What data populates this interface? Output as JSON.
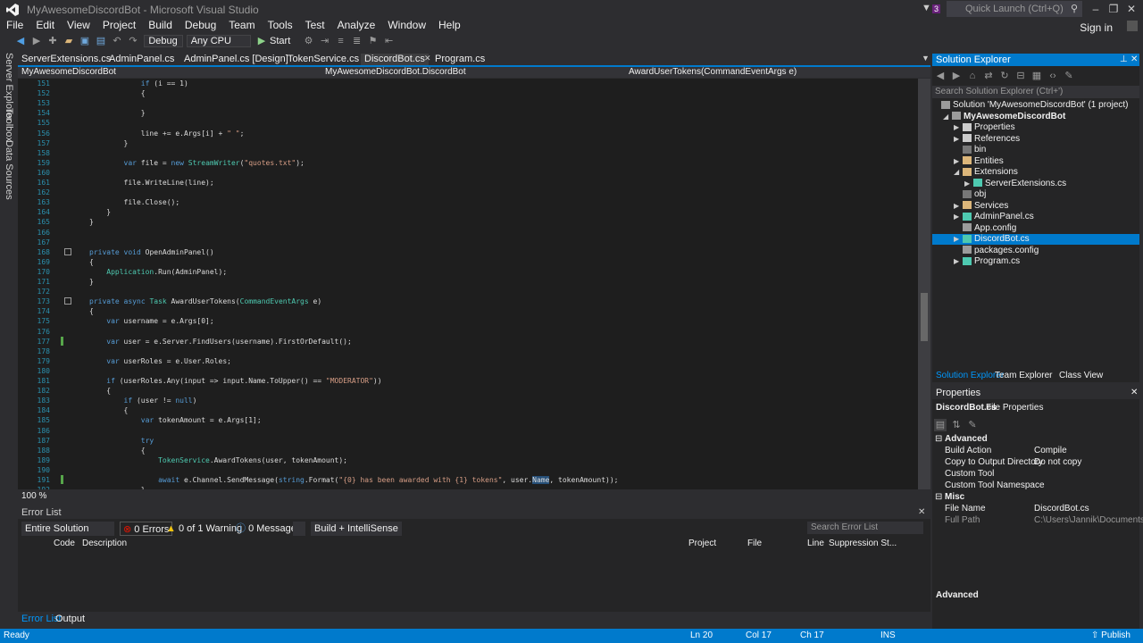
{
  "window": {
    "title": "MyAwesomeDiscordBot - Microsoft Visual Studio",
    "quick_launch_placeholder": "Quick Launch (Ctrl+Q)",
    "notification_count": "3",
    "signin": "Sign in"
  },
  "menu": [
    "File",
    "Edit",
    "View",
    "Project",
    "Build",
    "Debug",
    "Team",
    "Tools",
    "Test",
    "Analyze",
    "Window",
    "Help"
  ],
  "toolbar": {
    "config": "Debug",
    "platform": "Any CPU",
    "start": "Start"
  },
  "left_rail": [
    "Server Explorer",
    "Toolbox",
    "Data Sources"
  ],
  "doc_tabs": [
    {
      "label": "ServerExtensions.cs"
    },
    {
      "label": "AdminPanel.cs"
    },
    {
      "label": "AdminPanel.cs [Design]"
    },
    {
      "label": "TokenService.cs"
    },
    {
      "label": "DiscordBot.cs"
    },
    {
      "label": "Program.cs"
    }
  ],
  "navbar": {
    "project": "MyAwesomeDiscordBot",
    "class": "MyAwesomeDiscordBot.DiscordBot",
    "member": "AwardUserTokens(CommandEventArgs e)"
  },
  "editor": {
    "zoom": "100 %",
    "lines": [
      {
        "n": "151",
        "t": "            if (i == 1)"
      },
      {
        "n": "152",
        "t": "            {"
      },
      {
        "n": "153",
        "t": ""
      },
      {
        "n": "154",
        "t": "            }"
      },
      {
        "n": "155",
        "t": ""
      },
      {
        "n": "156",
        "t": "            line += e.Args[i] + \" \";"
      },
      {
        "n": "157",
        "t": "        }"
      },
      {
        "n": "158",
        "t": ""
      },
      {
        "n": "159",
        "t": "        var file = new StreamWriter(\"quotes.txt\");"
      },
      {
        "n": "160",
        "t": ""
      },
      {
        "n": "161",
        "t": "        file.WriteLine(line);"
      },
      {
        "n": "162",
        "t": ""
      },
      {
        "n": "163",
        "t": "        file.Close();"
      },
      {
        "n": "164",
        "t": "    }"
      },
      {
        "n": "165",
        "t": "}"
      },
      {
        "n": "166",
        "t": ""
      },
      {
        "n": "167",
        "t": ""
      },
      {
        "n": "168",
        "t": "private void OpenAdminPanel()"
      },
      {
        "n": "169",
        "t": "{"
      },
      {
        "n": "170",
        "t": "    Application.Run(AdminPanel);"
      },
      {
        "n": "171",
        "t": "}"
      },
      {
        "n": "172",
        "t": ""
      },
      {
        "n": "173",
        "t": "private async Task AwardUserTokens(CommandEventArgs e)"
      },
      {
        "n": "174",
        "t": "{"
      },
      {
        "n": "175",
        "t": "    var username = e.Args[0];"
      },
      {
        "n": "176",
        "t": ""
      },
      {
        "n": "177",
        "t": "    var user = e.Server.FindUsers(username).FirstOrDefault();"
      },
      {
        "n": "178",
        "t": ""
      },
      {
        "n": "179",
        "t": "    var userRoles = e.User.Roles;"
      },
      {
        "n": "180",
        "t": ""
      },
      {
        "n": "181",
        "t": "    if (userRoles.Any(input => input.Name.ToUpper() == \"MODERATOR\"))"
      },
      {
        "n": "182",
        "t": "    {"
      },
      {
        "n": "183",
        "t": "        if (user != null)"
      },
      {
        "n": "184",
        "t": "        {"
      },
      {
        "n": "185",
        "t": "            var tokenAmount = e.Args[1];"
      },
      {
        "n": "186",
        "t": ""
      },
      {
        "n": "187",
        "t": "            try"
      },
      {
        "n": "188",
        "t": "            {"
      },
      {
        "n": "189",
        "t": "                TokenService.AwardTokens(user, tokenAmount);"
      },
      {
        "n": "190",
        "t": ""
      },
      {
        "n": "191",
        "t": "                await e.Channel.SendMessage(string.Format(\"{0} has been awarded with {1} tokens\", user.Name, tokenAmount));"
      },
      {
        "n": "192",
        "t": "            }"
      }
    ]
  },
  "error_list": {
    "title": "Error List",
    "scope": "Entire Solution",
    "errors": "0 Errors",
    "warnings": "0 of 1 Warning",
    "messages": "0 Messages",
    "filter": "Build + IntelliSense",
    "search_placeholder": "Search Error List",
    "columns": [
      "Code",
      "Description",
      "Project",
      "File",
      "Line",
      "Suppression St..."
    ]
  },
  "bottom_tabs": [
    "Error List",
    "Output"
  ],
  "statusbar": {
    "state": "Ready",
    "ln": "Ln 20",
    "col": "Col 17",
    "ch": "Ch 17",
    "ins": "INS",
    "publish": "Publish"
  },
  "solution_explorer": {
    "title": "Solution Explorer",
    "search_placeholder": "Search Solution Explorer (Ctrl+')",
    "items": [
      {
        "label": "Solution 'MyAwesomeDiscordBot' (1 project)",
        "depth": 0,
        "bold": false,
        "caret": ""
      },
      {
        "label": "MyAwesomeDiscordBot",
        "depth": 1,
        "bold": true,
        "caret": "◢"
      },
      {
        "label": "Properties",
        "depth": 2,
        "bold": false,
        "caret": "▶"
      },
      {
        "label": "References",
        "depth": 2,
        "bold": false,
        "caret": "▶"
      },
      {
        "label": "bin",
        "depth": 2,
        "bold": false,
        "caret": ""
      },
      {
        "label": "Entities",
        "depth": 2,
        "bold": false,
        "caret": "▶"
      },
      {
        "label": "Extensions",
        "depth": 2,
        "bold": false,
        "caret": "◢"
      },
      {
        "label": "ServerExtensions.cs",
        "depth": 3,
        "bold": false,
        "caret": "▶"
      },
      {
        "label": "obj",
        "depth": 2,
        "bold": false,
        "caret": ""
      },
      {
        "label": "Services",
        "depth": 2,
        "bold": false,
        "caret": "▶"
      },
      {
        "label": "AdminPanel.cs",
        "depth": 2,
        "bold": false,
        "caret": "▶"
      },
      {
        "label": "App.config",
        "depth": 2,
        "bold": false,
        "caret": ""
      },
      {
        "label": "DiscordBot.cs",
        "depth": 2,
        "bold": false,
        "caret": "▶",
        "selected": true
      },
      {
        "label": "packages.config",
        "depth": 2,
        "bold": false,
        "caret": ""
      },
      {
        "label": "Program.cs",
        "depth": 2,
        "bold": false,
        "caret": "▶"
      }
    ],
    "tabs": [
      "Solution Explorer",
      "Team Explorer",
      "Class View"
    ]
  },
  "properties": {
    "title": "Properties",
    "object": "DiscordBot.cs",
    "object_type": "File Properties",
    "cat_advanced": "Advanced",
    "cat_misc": "Misc",
    "rows_adv": [
      {
        "k": "Build Action",
        "v": "Compile"
      },
      {
        "k": "Copy to Output Directory",
        "v": "Do not copy"
      },
      {
        "k": "Custom Tool",
        "v": ""
      },
      {
        "k": "Custom Tool Namespace",
        "v": ""
      }
    ],
    "rows_misc": [
      {
        "k": "File Name",
        "v": "DiscordBot.cs"
      },
      {
        "k": "Full Path",
        "v": "C:\\Users\\Jannik\\Documents\\Visu"
      }
    ],
    "footer": "Advanced"
  }
}
